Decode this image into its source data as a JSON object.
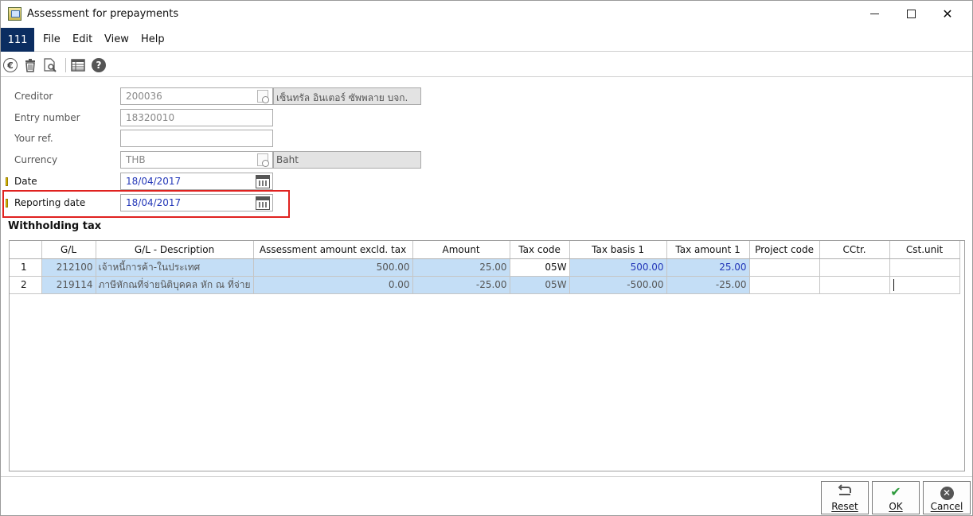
{
  "window": {
    "title": "Assessment for prepayments",
    "close_glyph": "✕"
  },
  "menu": {
    "company": "111",
    "items": [
      "File",
      "Edit",
      "View",
      "Help"
    ]
  },
  "toolbar": {
    "icons": [
      "euro-icon",
      "trash-icon",
      "preview-icon",
      "table-icon",
      "help-icon"
    ],
    "euro_glyph": "€",
    "help_glyph": "?"
  },
  "form": {
    "creditor": {
      "label": "Creditor",
      "value": "200036",
      "description": "เซ็นทรัล อินเตอร์ ซัพพลาย บจก."
    },
    "entry_number": {
      "label": "Entry number",
      "value": "18320010"
    },
    "your_ref": {
      "label": "Your ref.",
      "value": ""
    },
    "currency": {
      "label": "Currency",
      "value": "THB",
      "description": "Baht"
    },
    "date": {
      "label": "Date",
      "value": "18/04/2017"
    },
    "reporting_date": {
      "label": "Reporting date",
      "value": "18/04/2017"
    }
  },
  "withholding_tax": {
    "title": "Withholding tax",
    "columns": [
      "",
      "G/L",
      "G/L - Description",
      "Assessment amount excld. tax",
      "Amount",
      "Tax code",
      "Tax basis 1",
      "Tax amount 1",
      "Project code",
      "CCtr.",
      "Cst.unit"
    ],
    "rows": [
      {
        "no": "1",
        "gl": "212100",
        "desc": "เจ้าหนี้การค้า-ในประเทศ",
        "assess": "500.00",
        "amount": "25.00",
        "tax_code": "05W",
        "basis": "500.00",
        "tax_amount": "25.00",
        "project": "",
        "cctr": "",
        "cst": ""
      },
      {
        "no": "2",
        "gl": "219114",
        "desc": "ภาษีหักณที่จ่ายนิติบุคคล หัก ณ ที่จ่าย",
        "assess": "0.00",
        "amount": "-25.00",
        "tax_code": "05W",
        "basis": "-500.00",
        "tax_amount": "-25.00",
        "project": "",
        "cctr": "",
        "cst": ""
      }
    ]
  },
  "buttons": {
    "reset": {
      "label": "Reset",
      "glyph": "⮐"
    },
    "ok": {
      "label": "OK",
      "glyph": "✔"
    },
    "cancel": {
      "label": "Cancel",
      "glyph": "✕"
    }
  },
  "colors": {
    "accent_navy": "#0b2d61",
    "highlight_red": "#e0221f",
    "selection_blue": "#c4def6",
    "value_blue": "#2337b8"
  }
}
